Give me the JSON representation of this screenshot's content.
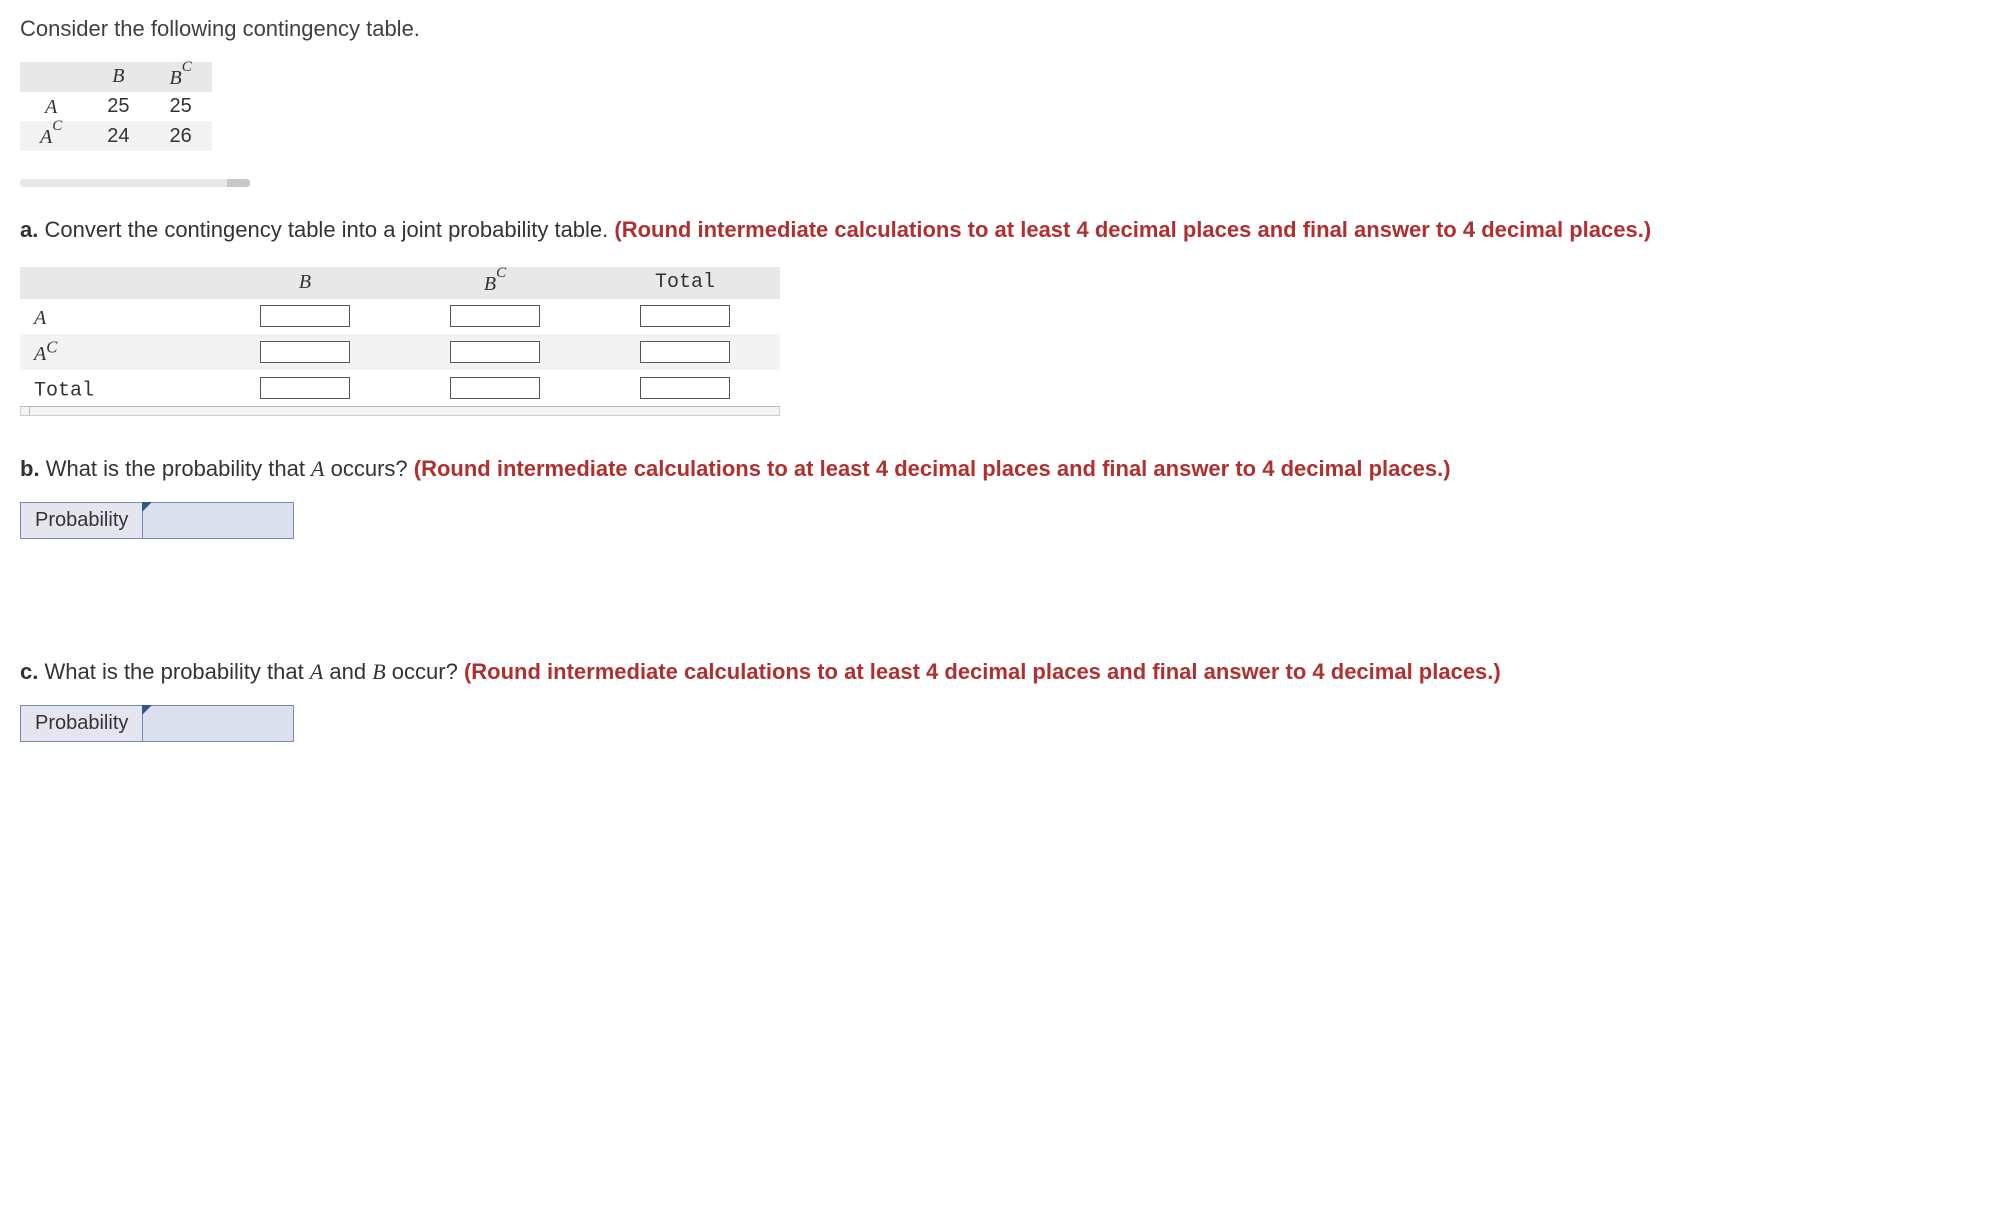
{
  "intro": "Consider the following contingency table.",
  "ctable": {
    "col_empty": "",
    "col_b": "B",
    "col_bc_base": "B",
    "col_bc_sup": "C",
    "rows": [
      {
        "hdr_base": "A",
        "hdr_sup": "",
        "v1": "25",
        "v2": "25"
      },
      {
        "hdr_base": "A",
        "hdr_sup": "C",
        "v1": "24",
        "v2": "26"
      }
    ]
  },
  "a": {
    "label": "a.",
    "text": "Convert the contingency table into a joint probability table. ",
    "note": "(Round intermediate calculations to at least 4 decimal places and final answer to 4 decimal places.)",
    "headers": {
      "c0": "",
      "c1": "B",
      "c2_base": "B",
      "c2_sup": "C",
      "c3": "Total"
    },
    "row_labels": [
      {
        "base": "A",
        "sup": "",
        "plain": ""
      },
      {
        "base": "A",
        "sup": "C",
        "plain": ""
      },
      {
        "base": "",
        "sup": "",
        "plain": "Total"
      }
    ]
  },
  "b": {
    "label": "b.",
    "text_before": "What is the probability that ",
    "var1": "A",
    "text_after": " occurs? ",
    "note": "(Round intermediate calculations to at least 4 decimal places and final answer to 4 decimal places.)",
    "prob_label": "Probability"
  },
  "c": {
    "label": "c.",
    "text_before": "What is the probability that ",
    "var1": "A",
    "mid": " and ",
    "var2": "B",
    "text_after": " occur? ",
    "note": "(Round intermediate calculations to at least 4 decimal places and final answer to 4 decimal places.)",
    "prob_label": "Probability"
  }
}
